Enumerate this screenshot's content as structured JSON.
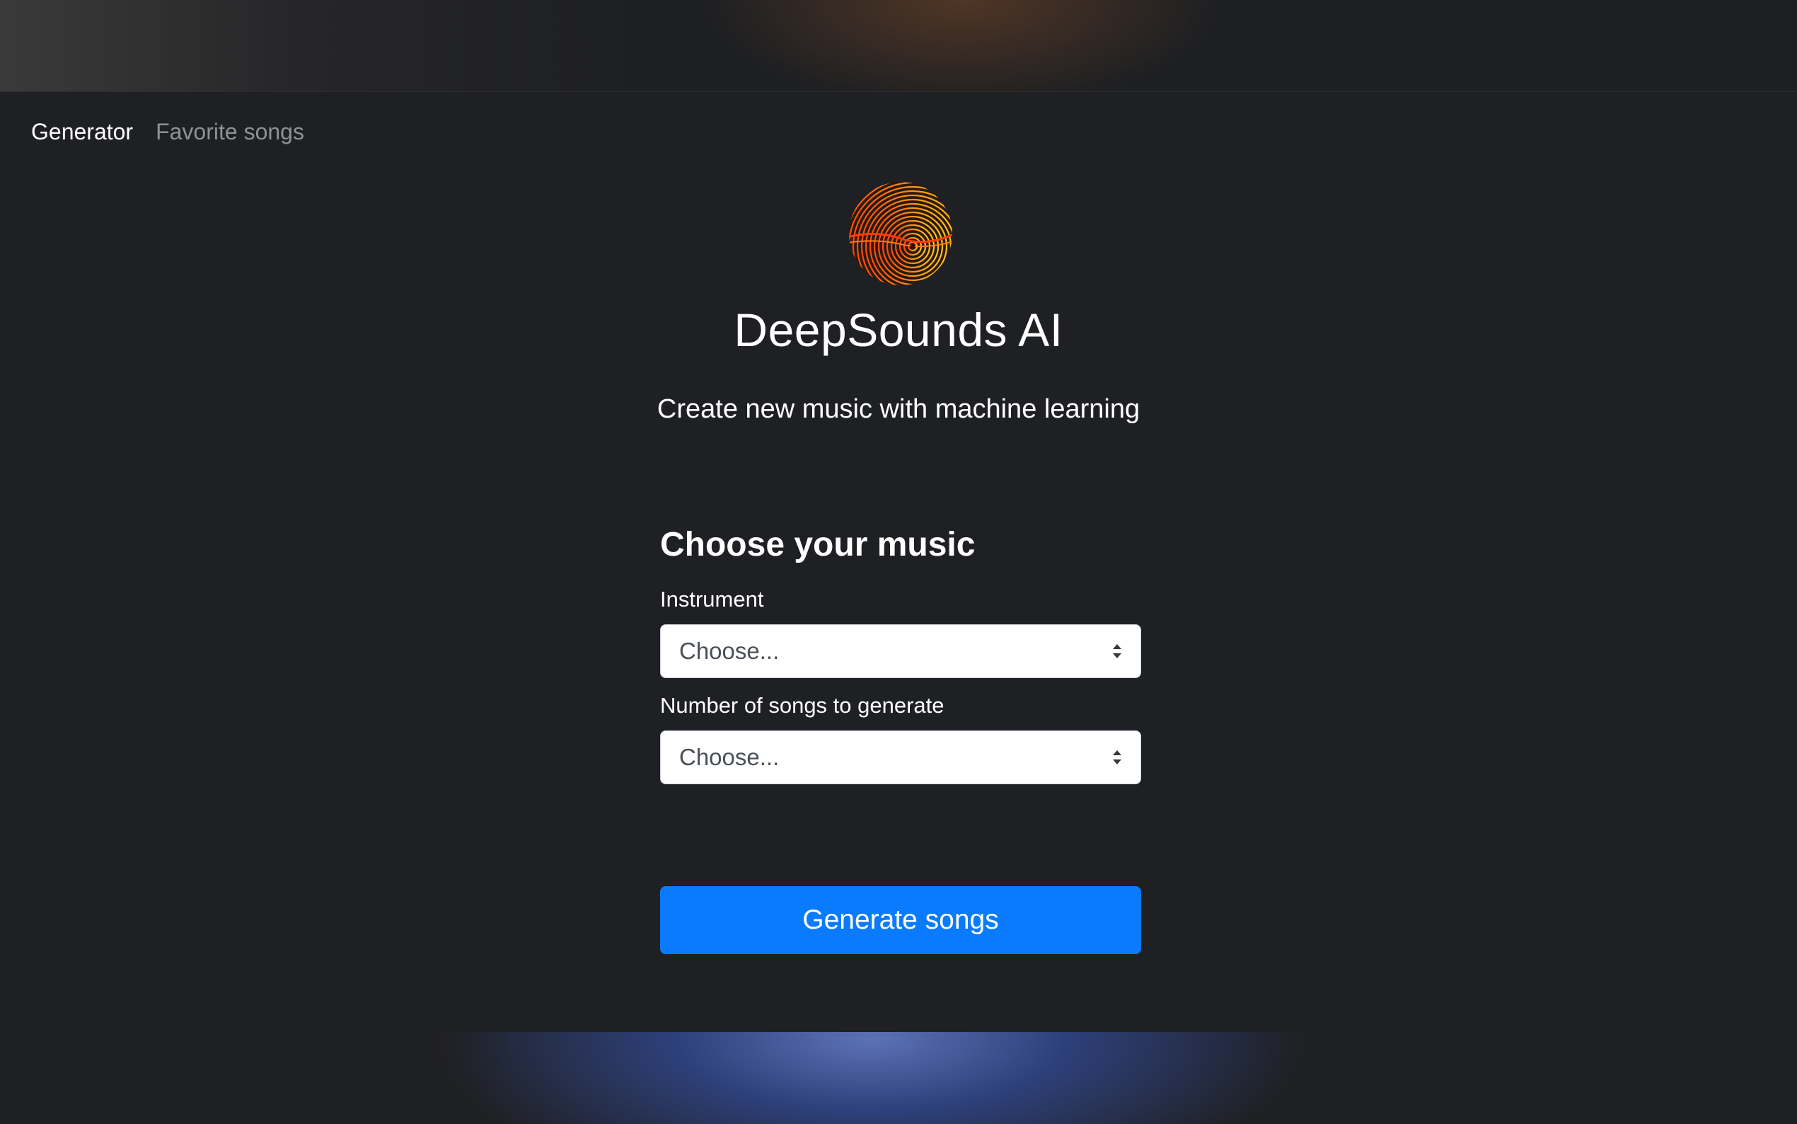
{
  "nav": {
    "items": [
      {
        "label": "Generator",
        "active": true
      },
      {
        "label": "Favorite songs",
        "active": false
      }
    ]
  },
  "brand": {
    "logo_icon": "soundwave-disc-logo-icon",
    "name": "DeepSounds AI",
    "tagline": "Create new music with machine learning"
  },
  "form": {
    "heading": "Choose your music",
    "instrument": {
      "label": "Instrument",
      "selected": "Choose..."
    },
    "song_count": {
      "label": "Number of songs to generate",
      "selected": "Choose..."
    },
    "submit_label": "Generate songs"
  },
  "colors": {
    "background": "#1f2023",
    "primary_button": "#0a7bff",
    "logo_gradient_start": "#ff4a10",
    "logo_gradient_end": "#ffc21a"
  }
}
